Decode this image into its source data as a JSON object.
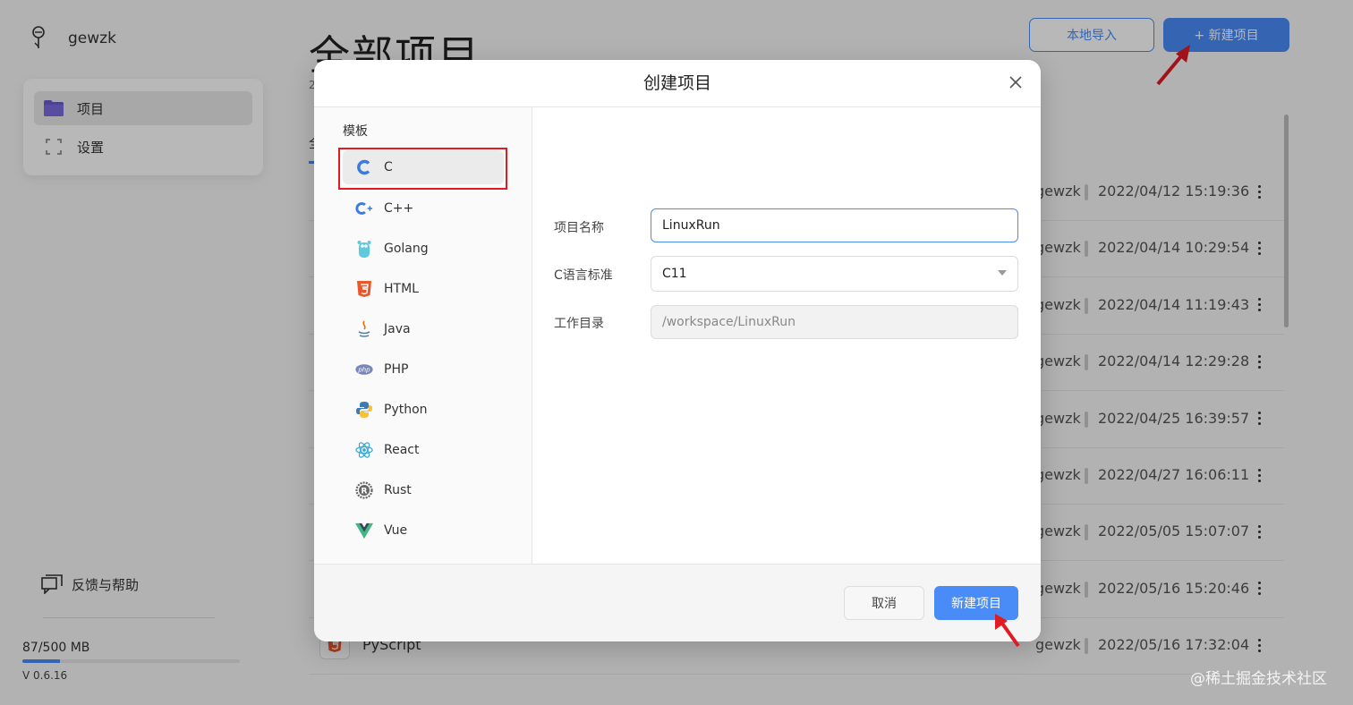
{
  "user": {
    "name": "gewzk"
  },
  "sidebar": {
    "items": [
      {
        "label": "项目",
        "icon": "folder-icon",
        "active": true
      },
      {
        "label": "设置",
        "icon": "gear-icon",
        "active": false
      }
    ],
    "feedback_label": "反馈与帮助",
    "storage_label": "87/500 MB",
    "storage_used_fraction": 0.174,
    "version": "V 0.6.16"
  },
  "main": {
    "title": "全部项目",
    "count_fragment": "2",
    "tab_fragment": "全",
    "import_label": "本地导入",
    "new_project_label": "+ 新建项目",
    "rows": [
      {
        "owner": "gewzk",
        "time": "2022/04/12 15:19:36"
      },
      {
        "owner": "gewzk",
        "time": "2022/04/14 10:29:54"
      },
      {
        "owner": "gewzk",
        "time": "2022/04/14 11:19:43"
      },
      {
        "owner": "gewzk",
        "time": "2022/04/14 12:29:28"
      },
      {
        "owner": "gewzk",
        "time": "2022/04/25 16:39:57"
      },
      {
        "owner": "gewzk",
        "time": "2022/04/27 16:06:11"
      },
      {
        "owner": "gewzk",
        "time": "2022/05/05 15:07:07"
      },
      {
        "owner": "gewzk",
        "time": "2022/05/16 15:20:46"
      },
      {
        "owner": "gewzk",
        "time": "2022/05/16 17:32:04",
        "name": "PyScript"
      }
    ]
  },
  "modal": {
    "title": "创建项目",
    "templates_heading": "模板",
    "templates": [
      {
        "label": "C",
        "icon": "c-icon",
        "color": "#3b7be0"
      },
      {
        "label": "C++",
        "icon": "cpp-icon",
        "color": "#3b7be0"
      },
      {
        "label": "Golang",
        "icon": "golang-icon",
        "color": "#5fc9dd"
      },
      {
        "label": "HTML",
        "icon": "html5-icon",
        "color": "#e9582a"
      },
      {
        "label": "Java",
        "icon": "java-icon",
        "color": "#e76f00"
      },
      {
        "label": "PHP",
        "icon": "php-icon",
        "color": "#7a86b8"
      },
      {
        "label": "Python",
        "icon": "python-icon",
        "color": "#3f7ab5"
      },
      {
        "label": "React",
        "icon": "react-icon",
        "color": "#35a9d4"
      },
      {
        "label": "Rust",
        "icon": "rust-icon",
        "color": "#666666"
      },
      {
        "label": "Vue",
        "icon": "vue-icon",
        "color": "#41b883"
      }
    ],
    "selected_template": "C",
    "form": {
      "name_label": "项目名称",
      "name_value": "LinuxRun",
      "std_label": "C语言标准",
      "std_value": "C11",
      "dir_label": "工作目录",
      "dir_value": "/workspace/LinuxRun"
    },
    "cancel_label": "取消",
    "create_label": "新建项目"
  },
  "watermark": "@稀土掘金技术社区",
  "colors": {
    "accent": "#4a8cf7",
    "highlight": "#e01b22"
  }
}
